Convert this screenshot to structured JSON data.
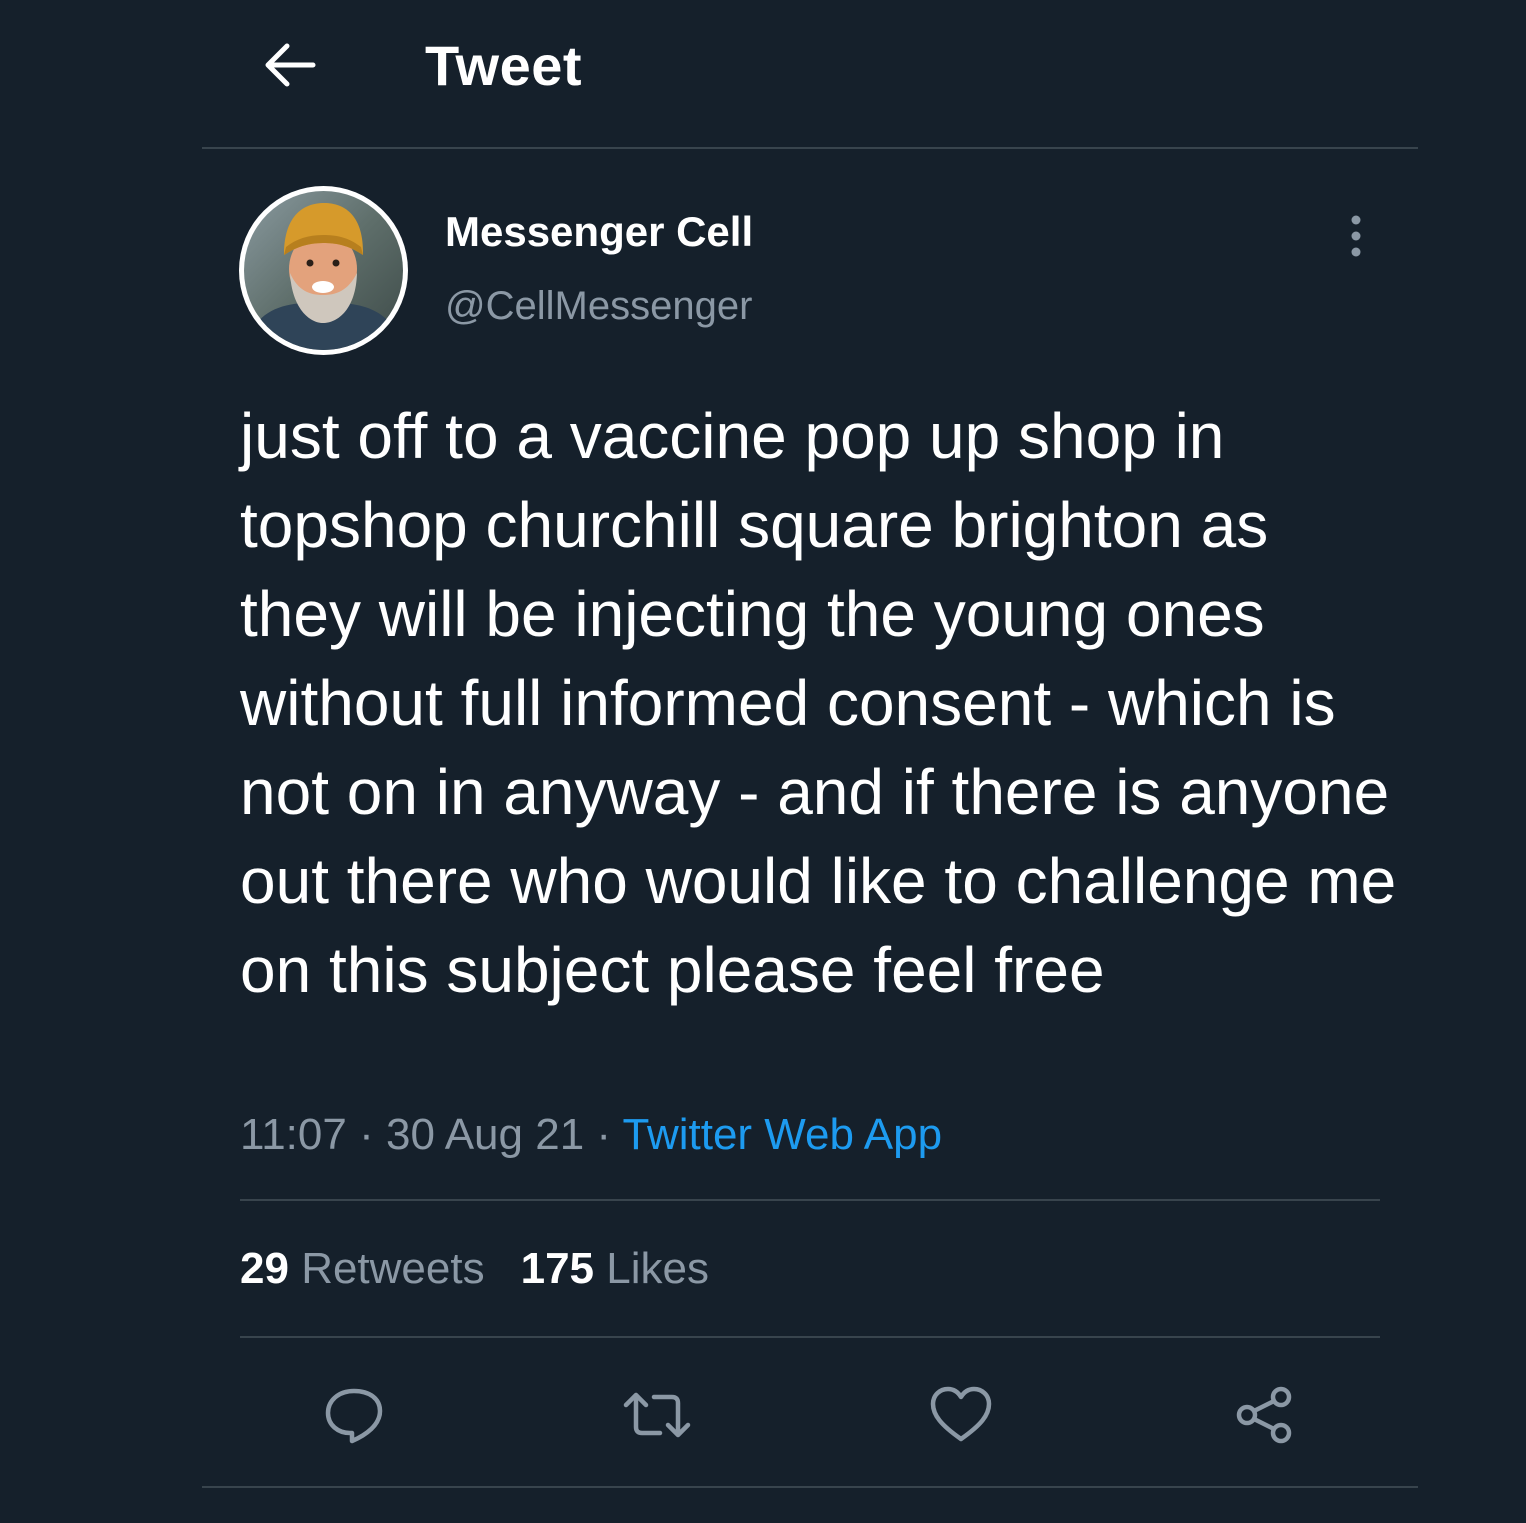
{
  "header": {
    "title": "Tweet",
    "back_icon": "arrow-left-icon"
  },
  "author": {
    "display_name": "Messenger Cell",
    "handle": "@CellMessenger",
    "more_icon": "more-vertical-icon"
  },
  "tweet": {
    "text": "just off to a vaccine pop up shop in topshop churchill square brighton as they will be injecting the young ones without full informed consent - which is not on in anyway - and if there is anyone out there who would like to challenge me on this subject please feel free",
    "time": "11:07",
    "date": "30 Aug 21",
    "separator": "·",
    "source": "Twitter Web App"
  },
  "stats": {
    "retweets_count": "29",
    "retweets_label": "Retweets",
    "likes_count": "175",
    "likes_label": "Likes"
  },
  "actions": [
    "reply-icon",
    "retweet-icon",
    "like-icon",
    "share-icon"
  ],
  "colors": {
    "background": "#15202b",
    "divider": "#38444d",
    "primary_text": "#ffffff",
    "secondary_text": "#8b98a5",
    "accent": "#1d9bf0"
  }
}
